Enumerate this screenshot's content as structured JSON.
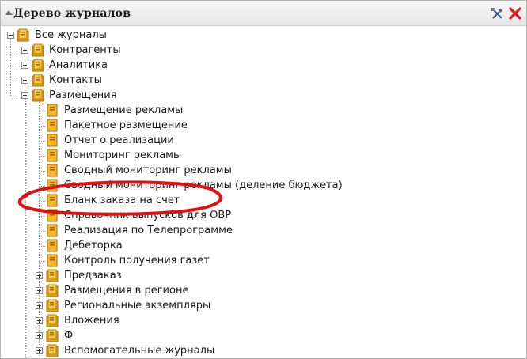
{
  "panel": {
    "title": "Дерево журналов"
  },
  "toolbar": {
    "settings_icon": "tools-icon",
    "close_icon": "close-icon",
    "close_color": "#d81e1e"
  },
  "tree": {
    "root": "Все журналы",
    "items": [
      "Контрагенты",
      "Аналитика",
      "Контакты",
      "Размещения"
    ],
    "placements": [
      "Размещение рекламы",
      "Пакетное размещение",
      "Отчет о реализации",
      "Мониторинг рекламы",
      "Сводный мониторинг рекламы",
      "Сводный мониторинг рекламы (деление бюджета)",
      "Бланк заказа на счет",
      "Справочник выпусков для ОВР",
      "Реализация по Телепрограмме",
      "Дебеторка",
      "Контроль получения газет"
    ],
    "subgroups": [
      "Предзаказ",
      "Размещения в регионе",
      "Региональные экземпляры",
      "Вложения",
      "Ф",
      "Вспомогательные журналы"
    ]
  },
  "highlight": {
    "color": "#e01010",
    "target": "Бланк заказа на счет"
  }
}
